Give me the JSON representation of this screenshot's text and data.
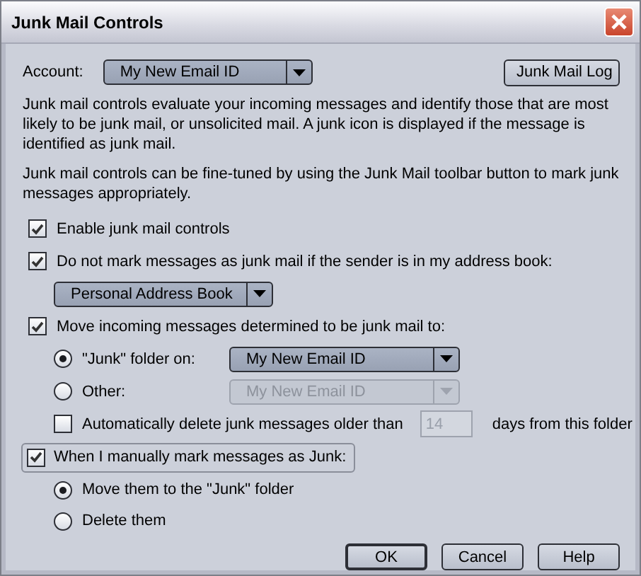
{
  "window": {
    "title": "Junk Mail Controls"
  },
  "account": {
    "label": "Account:",
    "value": "My New Email ID"
  },
  "log_button": "Junk Mail Log",
  "paragraphs": [
    "Junk mail controls evaluate your incoming messages and identify those that are most likely to be junk mail, or unsolicited mail. A junk icon is displayed if the message is identified as junk mail.",
    "Junk mail controls can be fine-tuned by using the Junk Mail toolbar button to mark junk messages appropriately."
  ],
  "enable": {
    "label": "Enable junk mail controls",
    "checked": true
  },
  "whitelist": {
    "label": "Do not mark messages as junk mail if the sender is in my address book:",
    "checked": true,
    "book": "Personal Address Book"
  },
  "move": {
    "label": "Move incoming messages determined to be junk mail to:",
    "checked": true,
    "targets": [
      {
        "label": "\"Junk\" folder on:",
        "selected": true,
        "account": "My New Email ID",
        "disabled": false
      },
      {
        "label": "Other:",
        "selected": false,
        "account": "My New Email ID",
        "disabled": true
      }
    ]
  },
  "purge": {
    "label": "Automatically delete junk messages older than",
    "checked": false,
    "days": "14",
    "days_disabled": true,
    "suffix": "days from this folder"
  },
  "manual": {
    "label": "When I manually mark messages as Junk:",
    "checked": true,
    "focused": true,
    "actions": [
      {
        "label": "Move them to the \"Junk\" folder",
        "selected": true
      },
      {
        "label": "Delete them",
        "selected": false
      }
    ]
  },
  "buttons": [
    {
      "label": "OK",
      "default": true
    },
    {
      "label": "Cancel",
      "default": false
    },
    {
      "label": "Help",
      "default": false
    }
  ]
}
